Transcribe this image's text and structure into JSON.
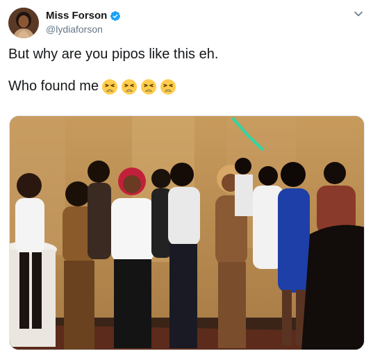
{
  "user": {
    "display_name": "Miss Forson",
    "handle": "@lydiaforson",
    "verified": true,
    "verified_color": "#1da1f2"
  },
  "tweet": {
    "line1": "But why are you pipos like this eh.",
    "line2": "Who found me",
    "emoji_count": 4,
    "emoji_name": "weary-face"
  },
  "icons": {
    "avatar": "profile-photo",
    "verified": "verified-badge-icon",
    "menu": "chevron-down-icon",
    "emoji": "weary-face-emoji-icon"
  },
  "colors": {
    "text": "#14171a",
    "secondary": "#657786",
    "border": "#e1e8ed",
    "accent": "#1da1f2"
  }
}
